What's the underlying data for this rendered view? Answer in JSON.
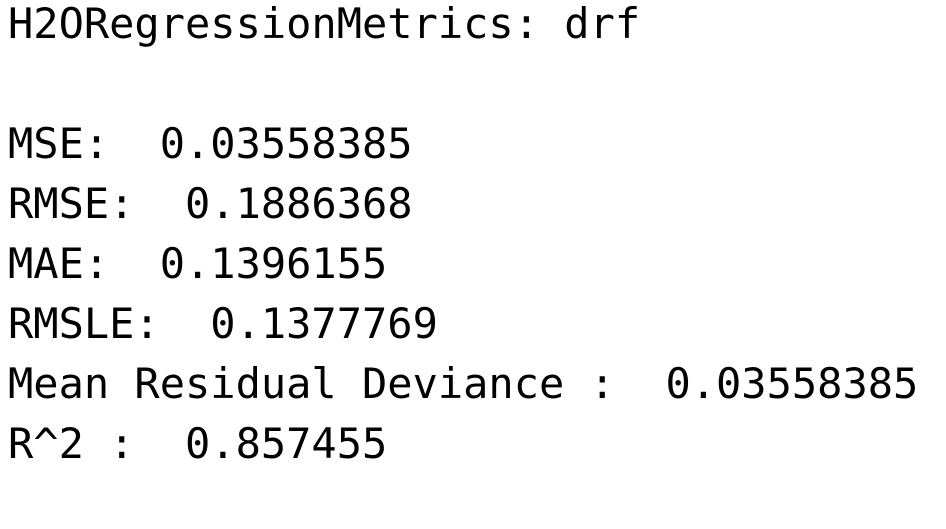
{
  "output": {
    "title": "H2ORegressionMetrics: drf",
    "lines": [
      "MSE:  0.03558385",
      "RMSE:  0.1886368",
      "MAE:  0.1396155",
      "RMSLE:  0.1377769",
      "Mean Residual Deviance :  0.03558385",
      "R^2 :  0.857455"
    ]
  }
}
